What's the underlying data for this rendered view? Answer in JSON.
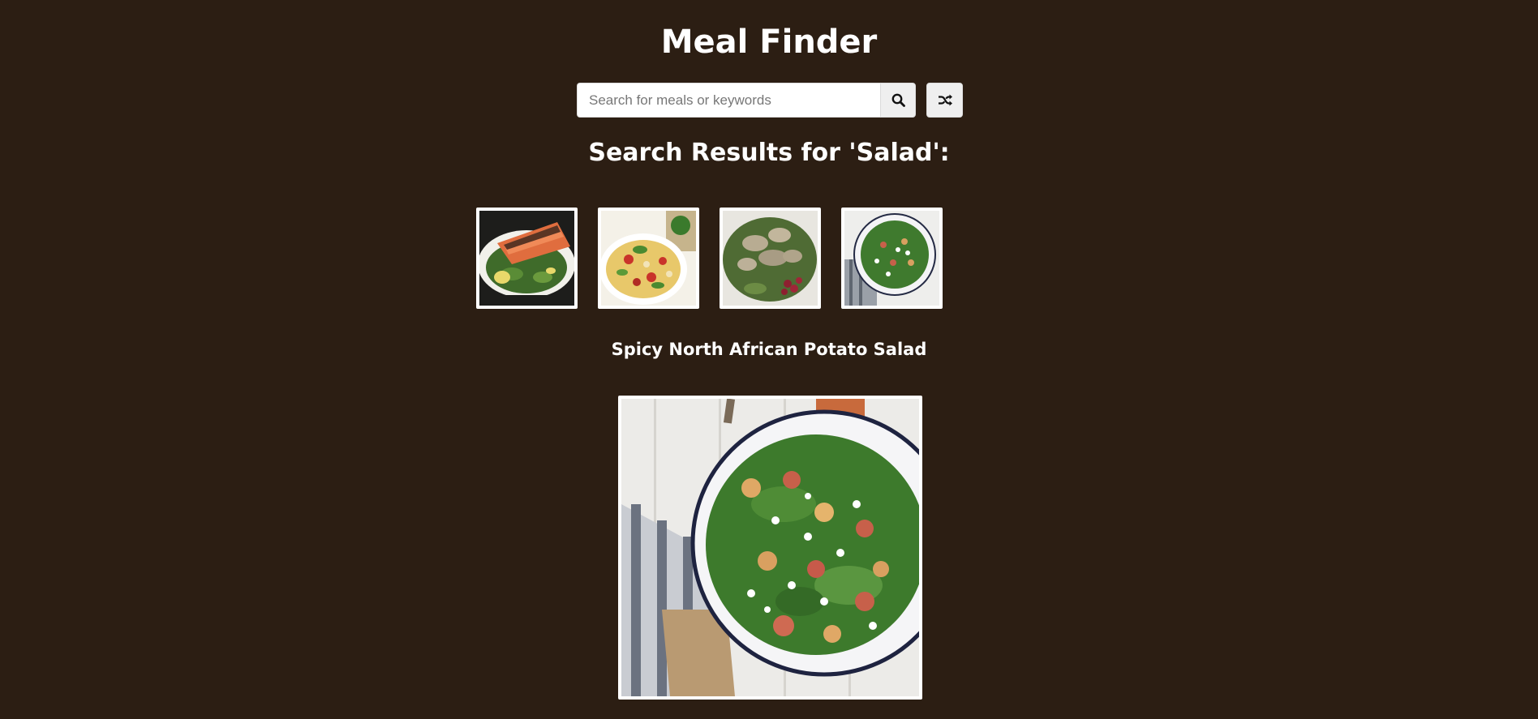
{
  "header": {
    "title": "Meal Finder"
  },
  "search": {
    "placeholder": "Search for meals or keywords",
    "value": "",
    "search_icon": "search-icon",
    "random_icon": "shuffle-icon"
  },
  "results": {
    "heading": "Search Results for 'Salad':",
    "meals": [
      {
        "photo": "salmon-salad-photo"
      },
      {
        "photo": "pasta-salad-photo"
      },
      {
        "photo": "chicken-salad-photo"
      },
      {
        "photo": "potato-salad-photo"
      }
    ]
  },
  "selected_meal": {
    "name": "Spicy North African Potato Salad",
    "photo": "potato-salad-photo"
  },
  "colors": {
    "background": "#2c1e13",
    "text": "#ffffff",
    "button_bg": "#efefef"
  }
}
